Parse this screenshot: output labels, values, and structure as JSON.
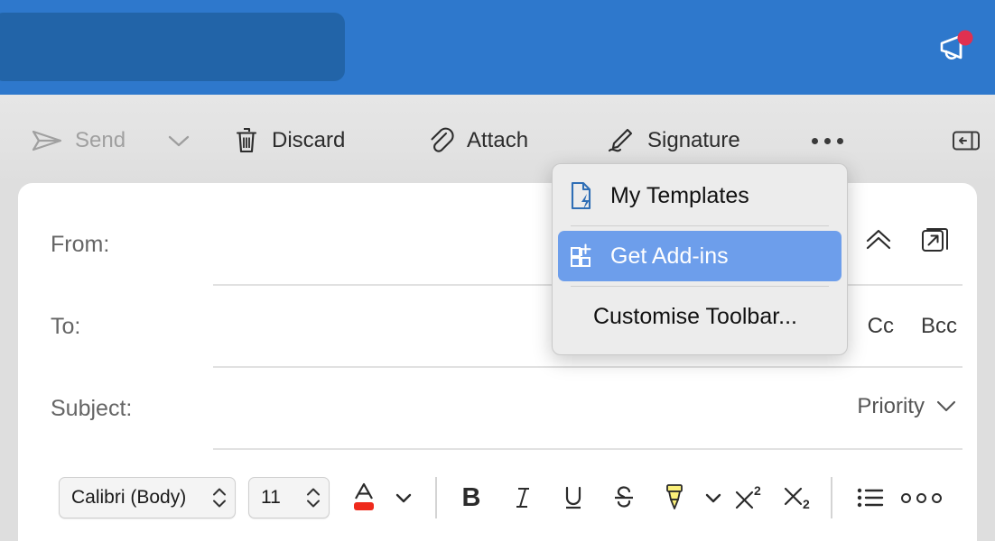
{
  "window": {
    "app": "mail-compose",
    "header_accent_color": "#2e78cc",
    "header_tab_color": "#2264a8"
  },
  "header": {
    "announce_icon": "megaphone-icon",
    "badge_color": "#e03050",
    "has_notification_badge": true
  },
  "toolbar": {
    "send_label": "Send",
    "send_disabled": true,
    "send_icon": "paper-plane-icon",
    "send_caret_icon": "chevron-down-icon",
    "discard_label": "Discard",
    "discard_icon": "trash-icon",
    "attach_label": "Attach",
    "attach_icon": "paperclip-icon",
    "signature_label": "Signature",
    "signature_icon": "signature-pen-icon",
    "more_icon": "ellipsis-icon",
    "panel_toggle_icon": "collapse-panel-icon"
  },
  "menu": {
    "open": true,
    "highlight_color": "#6d9eeb",
    "items": [
      {
        "label": "My Templates",
        "icon": "document-lightning-icon",
        "highlighted": false
      },
      {
        "label": "Get Add-ins",
        "icon": "grid-plus-icon",
        "highlighted": true
      },
      {
        "label": "Customise Toolbar...",
        "icon": "",
        "highlighted": false
      }
    ]
  },
  "compose": {
    "fields": [
      {
        "label": "From:",
        "value": "",
        "placeholder": ""
      },
      {
        "label": "To:",
        "value": "",
        "placeholder": ""
      },
      {
        "label": "Subject:",
        "value": "",
        "placeholder": ""
      }
    ],
    "from_actions": {
      "collapse_icon": "double-chevron-up-icon",
      "popout_icon": "open-in-new-window-icon"
    },
    "cc_label": "Cc",
    "bcc_label": "Bcc",
    "priority_label": "Priority",
    "priority_caret_icon": "chevron-down-icon"
  },
  "format_bar": {
    "font_family_value": "Calibri (Body)",
    "font_size_value": "11",
    "font_color_icon": "font-color-icon",
    "font_color_swatch": "#ef2a1c",
    "font_color_caret_icon": "chevron-down-icon",
    "bold_label": "B",
    "italic_label": "I",
    "underline_label": "U",
    "strikethrough_label": "S",
    "highlight_icon": "highlighter-icon",
    "highlight_swatch": "#fbf07a",
    "highlight_caret_icon": "chevron-down-icon",
    "superscript_label": "X2",
    "subscript_label": "X2",
    "bullet_list_icon": "bulleted-list-icon",
    "more_format_icon": "overflow-dots-icon"
  }
}
